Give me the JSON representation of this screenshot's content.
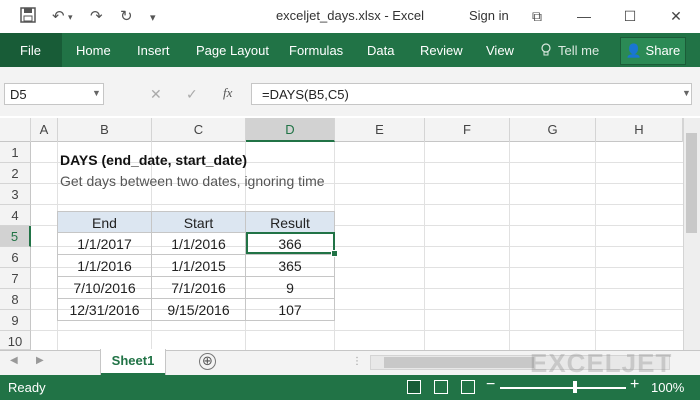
{
  "window": {
    "title": "exceljet_days.xlsx - Excel",
    "signin": "Sign in",
    "buttons": {
      "restore": "⧉",
      "minimize": "—",
      "maximize": "☐",
      "close": "✕"
    }
  },
  "quick_access": {
    "save_icon": "save-icon",
    "undo_icon": "undo-icon",
    "redo_icon": "redo-icon",
    "more_icon": "customize-icon"
  },
  "ribbon": {
    "tabs": [
      "File",
      "Home",
      "Insert",
      "Page Layout",
      "Formulas",
      "Data",
      "Review",
      "View"
    ],
    "tell_me": "Tell me",
    "share": "Share",
    "accent": "#217346"
  },
  "formula_bar": {
    "name_box": "D5",
    "cancel": "✕",
    "enter": "✓",
    "fx": "fx",
    "formula": "=DAYS(B5,C5)"
  },
  "grid": {
    "columns": [
      "A",
      "B",
      "C",
      "D",
      "E",
      "F",
      "G",
      "H"
    ],
    "rows": [
      "1",
      "2",
      "3",
      "4",
      "5",
      "6",
      "7",
      "8",
      "9",
      "10"
    ],
    "selected_cell": "D5",
    "cells": {
      "B1": "DAYS (end_date, start_date)",
      "B2": "Get days between two dates, ignoring time"
    },
    "table": {
      "headers": [
        "End",
        "Start",
        "Result"
      ],
      "rows": [
        [
          "1/1/2017",
          "1/1/2016",
          "366"
        ],
        [
          "1/1/2016",
          "1/1/2015",
          "365"
        ],
        [
          "7/10/2016",
          "7/1/2016",
          "9"
        ],
        [
          "12/31/2016",
          "9/15/2016",
          "107"
        ]
      ],
      "header_color": "#dce6f1"
    }
  },
  "sheets": {
    "tabs": [
      "Sheet1"
    ],
    "active": "Sheet1",
    "add": "⊕"
  },
  "watermark": "EXCELJET",
  "status": {
    "ready": "Ready",
    "zoom": "100%",
    "zoom_level": 1.0
  }
}
